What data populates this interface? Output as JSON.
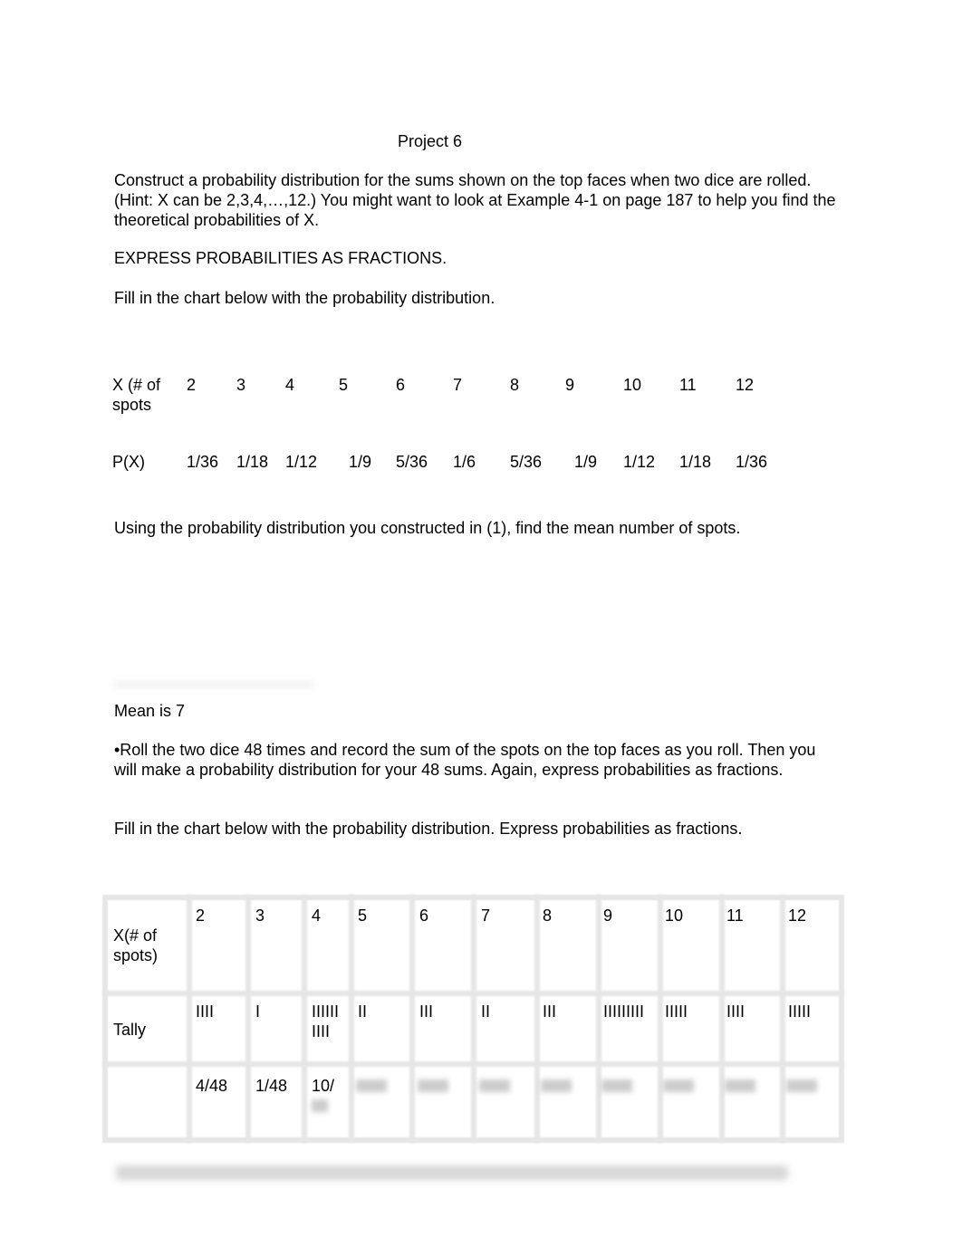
{
  "title": "Project 6",
  "intro": "Construct a probability distribution for the sums shown on the top faces when two dice are rolled. (Hint: X can be 2,3,4,…,12.) You might want to look at Example 4-1 on page 187 to help you find the theoretical probabilities of X.",
  "express": "EXPRESS PROBABILITIES AS FRACTIONS.",
  "fill1": "Fill in the chart below with the probability distribution.",
  "dist1": {
    "x_label_line1": "X (# of",
    "x_label_line2": "spots",
    "p_label": "P(X)",
    "x_values": [
      "2",
      "3",
      "4",
      "5",
      "6",
      "7",
      "8",
      "9",
      "10",
      "11",
      "12"
    ],
    "p_values": [
      "1/36",
      "1/18",
      "1/12",
      "1/9",
      "5/36",
      "1/6",
      "5/36",
      "1/9",
      "1/12",
      "1/18",
      "1/36"
    ]
  },
  "mean_question": "Using the probability distribution you constructed in (1), find the mean number of spots.",
  "mean_answer": "Mean is 7",
  "roll_instructions": "•Roll the two dice 48 times and record the sum of the spots on the top faces as you roll. Then you will make a probability distribution for your 48 sums. Again, express probabilities as fractions.",
  "fill2": "Fill in the chart below with the probability distribution. Express probabilities as fractions.",
  "dist2": {
    "x_label_line1": "X(# of",
    "x_label_line2": "spots)",
    "tally_label": "Tally",
    "x_values": [
      "2",
      "3",
      "4",
      "5",
      "6",
      "7",
      "8",
      "9",
      "10",
      "11",
      "12"
    ],
    "tallies": [
      "IIII",
      "I",
      "IIIIII\nIIII",
      "II",
      "III",
      "II",
      "III",
      "IIIIIIIII",
      "IIIII",
      "IIII",
      "IIIII"
    ],
    "probabilities_visible": [
      "4/48",
      "1/48",
      "10/"
    ]
  }
}
